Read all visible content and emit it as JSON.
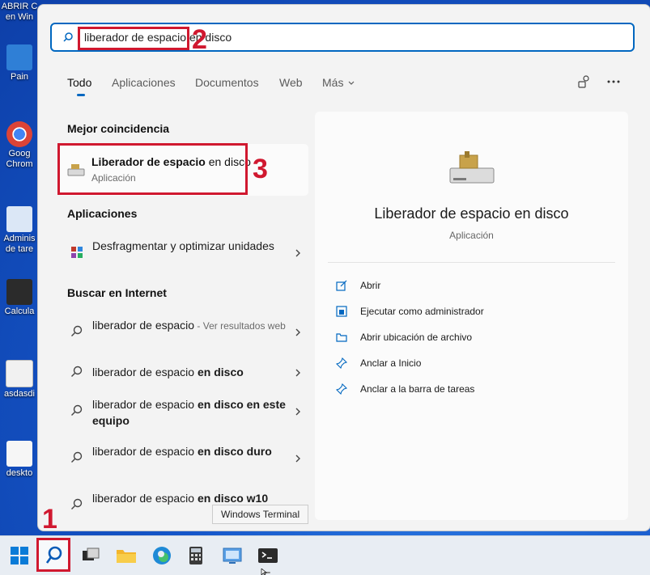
{
  "desktop": {
    "icons": [
      {
        "label": "ABRIR C\nen Win",
        "color": "#d8d8d8"
      },
      {
        "label": "Pain",
        "color": "#2f7fd6"
      },
      {
        "label": "Goog\nChrom",
        "color": "#dd4b39"
      },
      {
        "label": "Adminis\nde tare",
        "color": "#4f8ad1"
      },
      {
        "label": "Calcula",
        "color": "#2b2b2b"
      },
      {
        "label": "asdasdi",
        "color": "#f1f1f1"
      },
      {
        "label": "deskto",
        "color": "#f6f6f6"
      }
    ]
  },
  "search": {
    "query": "liberador de espacio en disco",
    "icon": "search-icon"
  },
  "annotations": [
    "1",
    "2",
    "3"
  ],
  "tabs": [
    {
      "label": "Todo"
    },
    {
      "label": "Aplicaciones"
    },
    {
      "label": "Documentos"
    },
    {
      "label": "Web"
    },
    {
      "label": "Más"
    }
  ],
  "left": {
    "best_match_title": "Mejor coincidencia",
    "best_match": {
      "name_bold": "Liberador de espacio",
      "name_rest": " en disco",
      "type": "Aplicación"
    },
    "apps_title": "Aplicaciones",
    "apps": [
      {
        "label": "Desfragmentar y optimizar unidades"
      }
    ],
    "web_title": "Buscar en Internet",
    "web": [
      {
        "plain": "liberador de espacio",
        "bold": "",
        "suffix": " - Ver resultados web"
      },
      {
        "plain": "liberador de espacio ",
        "bold": "en disco",
        "suffix": ""
      },
      {
        "plain": "liberador de espacio ",
        "bold": "en disco en este equipo",
        "suffix": ""
      },
      {
        "plain": "liberador de espacio ",
        "bold": "en disco duro",
        "suffix": ""
      },
      {
        "plain": "liberador de espacio ",
        "bold": "en disco w10",
        "suffix": ""
      }
    ]
  },
  "right": {
    "title": "Liberador de espacio en disco",
    "subtitle": "Aplicación",
    "actions": [
      {
        "label": "Abrir",
        "icon": "open-icon"
      },
      {
        "label": "Ejecutar como administrador",
        "icon": "shield-icon"
      },
      {
        "label": "Abrir ubicación de archivo",
        "icon": "folder-icon"
      },
      {
        "label": "Anclar a Inicio",
        "icon": "pin-icon"
      },
      {
        "label": "Anclar a la barra de tareas",
        "icon": "pin-icon"
      }
    ]
  },
  "tooltip": "Windows Terminal",
  "taskbar": [
    "windows-start-icon",
    "search-icon",
    "task-view-icon",
    "file-explorer-icon",
    "edge-icon",
    "calculator-icon",
    "control-panel-icon",
    "terminal-icon"
  ]
}
